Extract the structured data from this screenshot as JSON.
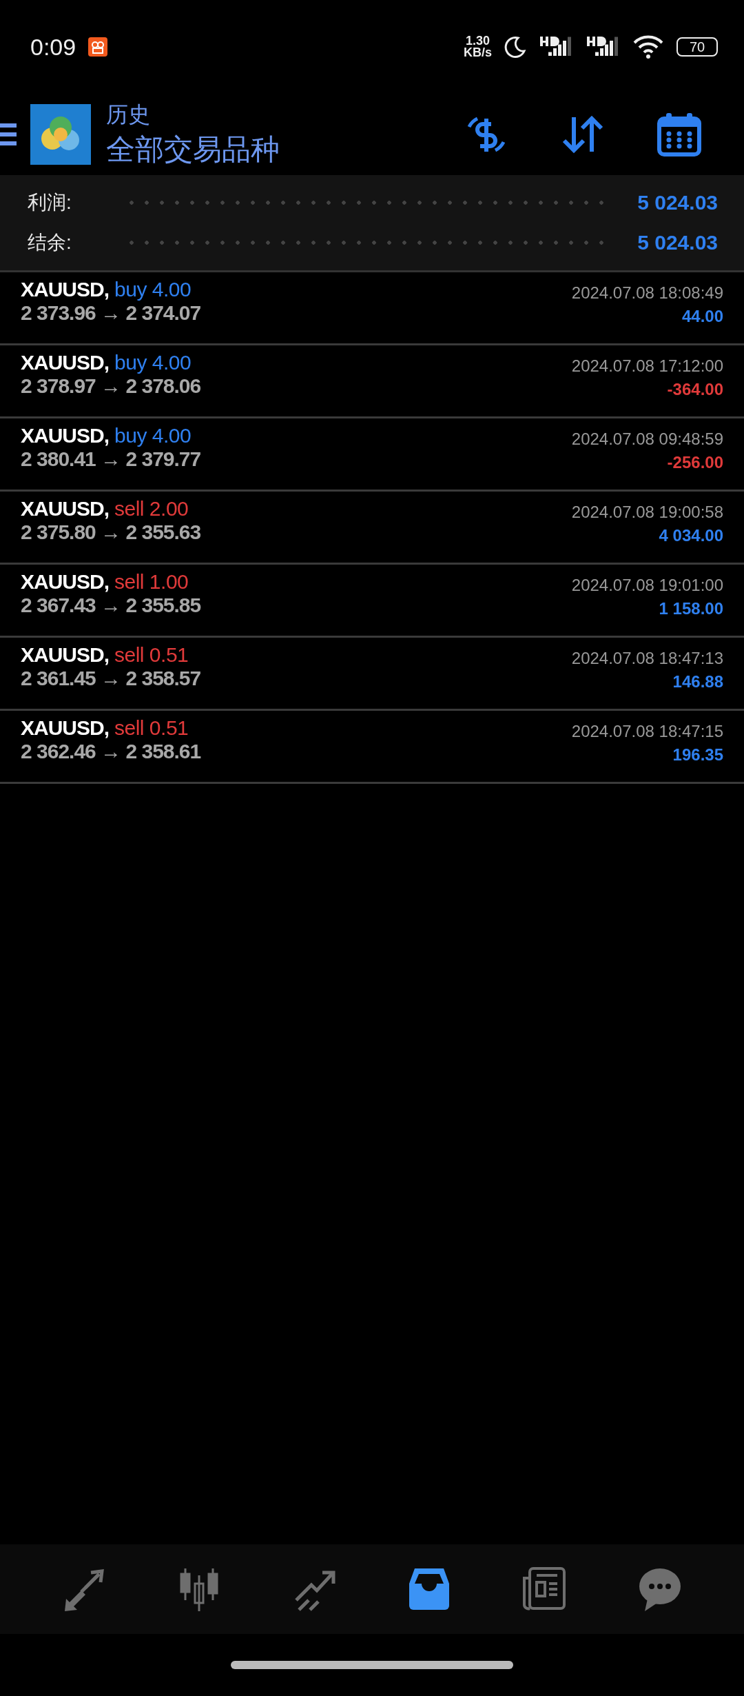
{
  "status_bar": {
    "time": "0:09",
    "speed_value": "1.30",
    "speed_unit": "KB/s",
    "battery": "70"
  },
  "header": {
    "subtitle": "历史",
    "title": "全部交易品种"
  },
  "summary": [
    {
      "label": "利润:",
      "value": "5 024.03"
    },
    {
      "label": "结余:",
      "value": "5 024.03"
    }
  ],
  "deals": [
    {
      "symbol": "XAUUSD,",
      "side": "buy",
      "volume": "4.00",
      "prices": "2 373.96 → 2 374.07",
      "time": "2024.07.08 18:08:49",
      "profit": "44.00",
      "loss": false
    },
    {
      "symbol": "XAUUSD,",
      "side": "buy",
      "volume": "4.00",
      "prices": "2 378.97 → 2 378.06",
      "time": "2024.07.08 17:12:00",
      "profit": "-364.00",
      "loss": true
    },
    {
      "symbol": "XAUUSD,",
      "side": "buy",
      "volume": "4.00",
      "prices": "2 380.41 → 2 379.77",
      "time": "2024.07.08 09:48:59",
      "profit": "-256.00",
      "loss": true
    },
    {
      "symbol": "XAUUSD,",
      "side": "sell",
      "volume": "2.00",
      "prices": "2 375.80 → 2 355.63",
      "time": "2024.07.08 19:00:58",
      "profit": "4 034.00",
      "loss": false
    },
    {
      "symbol": "XAUUSD,",
      "side": "sell",
      "volume": "1.00",
      "prices": "2 367.43 → 2 355.85",
      "time": "2024.07.08 19:01:00",
      "profit": "1 158.00",
      "loss": false
    },
    {
      "symbol": "XAUUSD,",
      "side": "sell",
      "volume": "0.51",
      "prices": "2 361.45 → 2 358.57",
      "time": "2024.07.08 18:47:13",
      "profit": "146.88",
      "loss": false
    },
    {
      "symbol": "XAUUSD,",
      "side": "sell",
      "volume": "0.51",
      "prices": "2 362.46 → 2 358.61",
      "time": "2024.07.08 18:47:15",
      "profit": "196.35",
      "loss": false
    }
  ],
  "nav": [
    {
      "selected": false
    },
    {
      "selected": false
    },
    {
      "selected": false
    },
    {
      "selected": true
    },
    {
      "selected": false
    },
    {
      "selected": false
    }
  ]
}
